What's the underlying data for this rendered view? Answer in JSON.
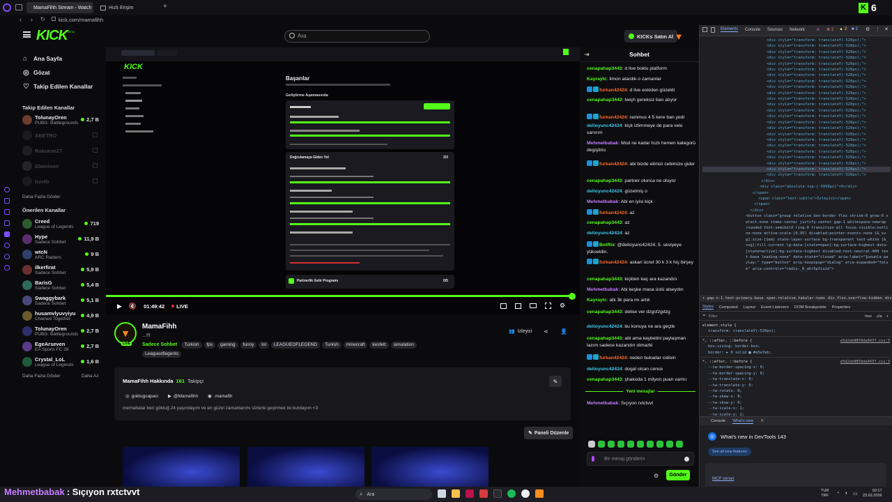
{
  "browser": {
    "tabs": [
      {
        "label": "MamaFihh Stream - Watch"
      },
      {
        "label": "Hızlı Erişim"
      }
    ],
    "url": "kick.com/mamafihh"
  },
  "header": {
    "logo": "KICK",
    "logo_sup": "BETA",
    "search_placeholder": "Ara",
    "buy_kicks": "KICKs Satın Al"
  },
  "sidebar": {
    "nav": [
      {
        "label": "Ana Sayfa",
        "icon": "home-icon"
      },
      {
        "label": "Gözat",
        "icon": "compass-icon"
      },
      {
        "label": "Takip Edilen Kanallar",
        "icon": "heart-icon"
      }
    ],
    "followed_title": "Takip Edilen Kanallar",
    "followed": [
      {
        "name": "TolunayOren",
        "category": "PUBG: Battlegrounds",
        "viewers": "2,7 B",
        "live": true
      },
      {
        "name": "AEETRO",
        "category": "",
        "viewers": "",
        "live": false
      },
      {
        "name": "Rakuexe27",
        "category": "",
        "viewers": "",
        "live": false
      },
      {
        "name": "Ebonivon",
        "category": "",
        "viewers": "",
        "live": false
      },
      {
        "name": "tun4b",
        "category": "",
        "viewers": "",
        "live": false
      }
    ],
    "show_more": "Daha Fazla Göster",
    "suggested_title": "Önerilen Kanallar",
    "suggested": [
      {
        "name": "Creed",
        "category": "League of Legends",
        "viewers": "719"
      },
      {
        "name": "Hype",
        "category": "Sadece Sohbet",
        "viewers": "11,9 B"
      },
      {
        "name": "wtcN",
        "category": "ARC Raiders",
        "viewers": "9 B"
      },
      {
        "name": "ilkerfirat",
        "category": "Sadece Sohbet",
        "viewers": "5,9 B"
      },
      {
        "name": "BarisG",
        "category": "Sadece Sohbet",
        "viewers": "5,4 B"
      },
      {
        "name": "Swaggybark",
        "category": "Sadece Sohbet",
        "viewers": "5,1 B"
      },
      {
        "name": "husamvlyuvyiyu",
        "category": "Chained Together",
        "viewers": "4,9 B"
      },
      {
        "name": "TolunayOren",
        "category": "PUBG: Battlegrounds",
        "viewers": "2,7 B"
      },
      {
        "name": "EgeArseven",
        "category": "EA Sports FC 26",
        "viewers": "2,7 B"
      },
      {
        "name": "Crystal_LoL",
        "category": "League of Legends",
        "viewers": "1,6 B"
      }
    ],
    "show_more2": "Daha Fazla Göster",
    "show_less": "Daha Az"
  },
  "video": {
    "time": "01:49:42",
    "live": "LIVE",
    "inner_title": "Başarılar",
    "inner_section": "Geliştirme Aşamasında",
    "inner_progress1": "2/3",
    "inner_progress2": "0/5",
    "inner_item1": "Doğrulamaya Giden Yol",
    "inner_item2": "Partnerlik Gelir Programı"
  },
  "channel": {
    "name": "MamaFihh",
    "subtitle": "...!!!",
    "category": "Sadece Sohbet",
    "tags": [
      "Turkish",
      "fps",
      "gaming",
      "funny",
      "lol",
      "LEAGUEOFLEGEND",
      "Turksh",
      "minecraft",
      "kesfett",
      "simulation",
      "Leagueoflegents"
    ],
    "viewers_label": "İzleyici",
    "about_title": "MamaFihh Hakkında",
    "followers": "161",
    "followers_label": "Takipçi",
    "links": [
      "goktugcapaci",
      "@Mamafihh",
      ".mamafih"
    ],
    "bio": "merhabalar ben göktuğ 24 yaşındayım ve en güzel zamanlarımı sizlerle geçirmek ile burdayım <3",
    "edit_panels": "Paneli Düzenle"
  },
  "chat": {
    "title": "Sohbet",
    "messages": [
      {
        "user": "cenapahap3443",
        "text": "d live boklu platform",
        "color": "#53fc18",
        "badge": false
      },
      {
        "user": "Kayraytc",
        "text": "limon atardık o zamanlar",
        "color": "#53fc18",
        "badge": false
      },
      {
        "user": "furkan42424",
        "text": "d live eskiden güzeldi",
        "color": "#ff6a2b",
        "badge": true
      },
      {
        "user": "cenapahap3443",
        "text": "twiçh gereksiz ban atıyor",
        "color": "#53fc18",
        "badge": false
      },
      {
        "user": "furkan42424",
        "text": "rammus 4 5 kere ban yedi",
        "color": "#ff6a2b",
        "badge": true
      },
      {
        "user": "delioyunc42424",
        "text": "kiçk izlimmeye de para velo sanırım",
        "color": "#3ec8f0",
        "badge": false
      },
      {
        "user": "Mehmetbabak",
        "text": "Mod ne kadar hızlı hemen kategorü degiştirio",
        "color": "#c77dff",
        "badge": false
      },
      {
        "user": "furkan42424",
        "text": "abi bizde elimizi cebimize gider",
        "color": "#ff6a2b",
        "badge": true
      },
      {
        "user": "cenapahap3443",
        "text": "partner olunca ne oluyor",
        "color": "#53fc18",
        "badge": false
      },
      {
        "user": "delioyunc42424",
        "text": "güzelmiş o",
        "color": "#3ec8f0",
        "badge": false
      },
      {
        "user": "Mehmetbabak",
        "text": "Abi en iyisi kiçk",
        "color": "#c77dff",
        "badge": false
      },
      {
        "user": "furkan42424",
        "text": "az",
        "color": "#ff6a2b",
        "badge": true
      },
      {
        "user": "cenapahap3443",
        "text": "az",
        "color": "#53fc18",
        "badge": false
      },
      {
        "user": "delioyunc42424",
        "text": "az",
        "color": "#3ec8f0",
        "badge": false
      },
      {
        "user": "BotRix",
        "text": "@delioyunc42424, 5. seviyeye yükseldin.",
        "color": "#53fc18",
        "badge": true
      },
      {
        "user": "furkan42424",
        "text": "askari ücret 30 k 3 k hiç birşey",
        "color": "#ff6a2b",
        "badge": true
      },
      {
        "user": "cenapahap3443",
        "text": "kiçkten kaç ara kazandın",
        "color": "#53fc18",
        "badge": false
      },
      {
        "user": "Mehmetbabak",
        "text": "Abi keşke masa üstü alseydın",
        "color": "#c77dff",
        "badge": false
      },
      {
        "user": "Kayraytc",
        "text": "abi 3k para mı artık",
        "color": "#53fc18",
        "badge": false
      },
      {
        "user": "cenapahap3443",
        "text": "delise ver dzgsfzgdzg",
        "color": "#53fc18",
        "badge": false
      },
      {
        "user": "delioyunc42424",
        "text": "bu konuya ne ara geçtik",
        "color": "#3ec8f0",
        "badge": false
      },
      {
        "user": "cenapahap3443",
        "text": "abi ama kaybetini paylaşman lazım sadece kazandın olmazki",
        "color": "#53fc18",
        "badge": false
      },
      {
        "user": "furkan42424",
        "text": "neden bukadar cidisin",
        "color": "#ff6a2b",
        "badge": true
      },
      {
        "user": "delioyunc42424",
        "text": "dogal olcan cence",
        "color": "#3ec8f0",
        "badge": false
      },
      {
        "user": "cenapahap3443",
        "text": "şhakoda 1 milyon puan varmı",
        "color": "#53fc18",
        "badge": false
      }
    ],
    "new_messages": "Yeni mesajlar",
    "last_user": "Mehmetbabak",
    "last_text": "Sıçıyon rxtctvvt",
    "input_placeholder": "Bir mesaj gönderin",
    "send": "Gönder"
  },
  "devtools": {
    "tabs": [
      "Elements",
      "Console",
      "Sources",
      "Network"
    ],
    "warn_count": "2",
    "dom_line": "<div style=\"transform: translateY(-520px);\">",
    "dom_tail": [
      "</div>",
      "<div class=\"absolute top-[-9999px]\">0</div>",
      "</span>",
      "<span class=\"text-subtle\">İzleyici</span>",
      "</span>",
      "</div>"
    ],
    "button_code": "<button class=\"group relative box-border flex shrink-0 grow-0 select-none items-center justify-center gap-1 whitespace-nowrap rounded font-semibold ring-0 transition-all focus-visible:outline-none active:scale-[0.95] disabled:pointer-events-none [&_svg]:size-[1em] state-layer-surface bg-transparent text-white [&_svg]:fill-current lg:data-[state=open]:bg-surface-highest data-[state=active]:bg-surface-highest disabled:text-neutral-600 text-base leading-none\" data-state=\"closed\" aria-label=\"Şununla paylaş:\" type=\"button\" aria-haspopup=\"dialog\" aria-expanded=\"false\" aria-controls=\"radix-_R_ahr5pfiuid\">",
    "breadcrumbs": [
      "r.gap-x-1.text-primary-base",
      "span.relative.tabular-nums",
      "div.flex.overflow-hidden",
      "div",
      "div"
    ],
    "style_tabs": [
      "Styles",
      "Computed",
      "Layout",
      "Event Listeners",
      "DOM Breakpoints",
      "Properties"
    ],
    "filter": "Filter",
    "hov": ":hov",
    "cls": ".cls",
    "rules": [
      {
        "sel": "element.style {",
        "src": "",
        "props": [
          "transform: translateY(-520px);"
        ]
      },
      {
        "sel": "*, ::after, ::before {",
        "src": "e5d2eb8859da0437.css:3",
        "props": [
          "box-sizing: border-box;",
          "border: ► 0 solid ■ #e5e7eb;"
        ]
      },
      {
        "sel": "*, ::after, ::before {",
        "src": "e5d2eb8859da0437.css:3",
        "props": [
          "--tw-border-spacing-x: 0;",
          "--tw-border-spacing-y: 0;",
          "--tw-translate-x: 0;",
          "--tw-translate-y: 0;",
          "--tw-rotate: 0;",
          "--tw-skew-x: 0;",
          "--tw-skew-y: 0;",
          "--tw-scale-x: 1;",
          "--tw-scale-y: 1;",
          "--tw-pan-x: ;"
        ]
      }
    ],
    "drawer_tabs": [
      "Console",
      "What's new"
    ],
    "whatsnew_title": "What's new in DevTools 143",
    "whatsnew_btn": "See all new features",
    "mcp": "MCP server"
  },
  "overlay": {
    "user": "Mehmetbabak",
    "text": ": Sıçıyon rxtctvvt"
  },
  "taskbar": {
    "search": "Ara",
    "lang1": "TUR",
    "lang2": "TRF",
    "time": "02:17",
    "date": "23.02.2026"
  },
  "topright": {
    "digit": "6"
  },
  "colors": {
    "brand": "#53fc18",
    "bg": "#0b0b0e",
    "devtools": "#1f1f23"
  }
}
